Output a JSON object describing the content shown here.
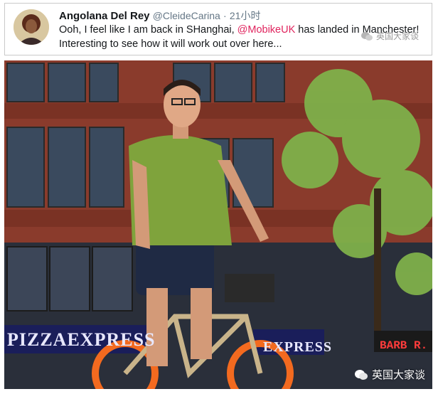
{
  "tweet": {
    "display_name": "Angolana Del Rey",
    "handle": "@CleideCarina",
    "separator": "·",
    "time": "21小时",
    "text_before": "Ooh, I feel like I am back in SHanghai, ",
    "mention": "@MobikeUK",
    "text_after": " has landed in Manchester! Interesting to see how it will work out over here..."
  },
  "watermark": {
    "top_label": "英国大家谈",
    "bottom_label": "英国大家谈",
    "icon": "wechat-icon"
  },
  "photo": {
    "sign_pizza": "PIZZAEXPRESS",
    "sign_express": "EXPRESS",
    "sign_barber": "BARB  R.",
    "colors": {
      "brick": "#8a3b2c",
      "shirt": "#7fa33c",
      "bike_orange": "#f36a1f",
      "mention": "#e0245e"
    }
  }
}
